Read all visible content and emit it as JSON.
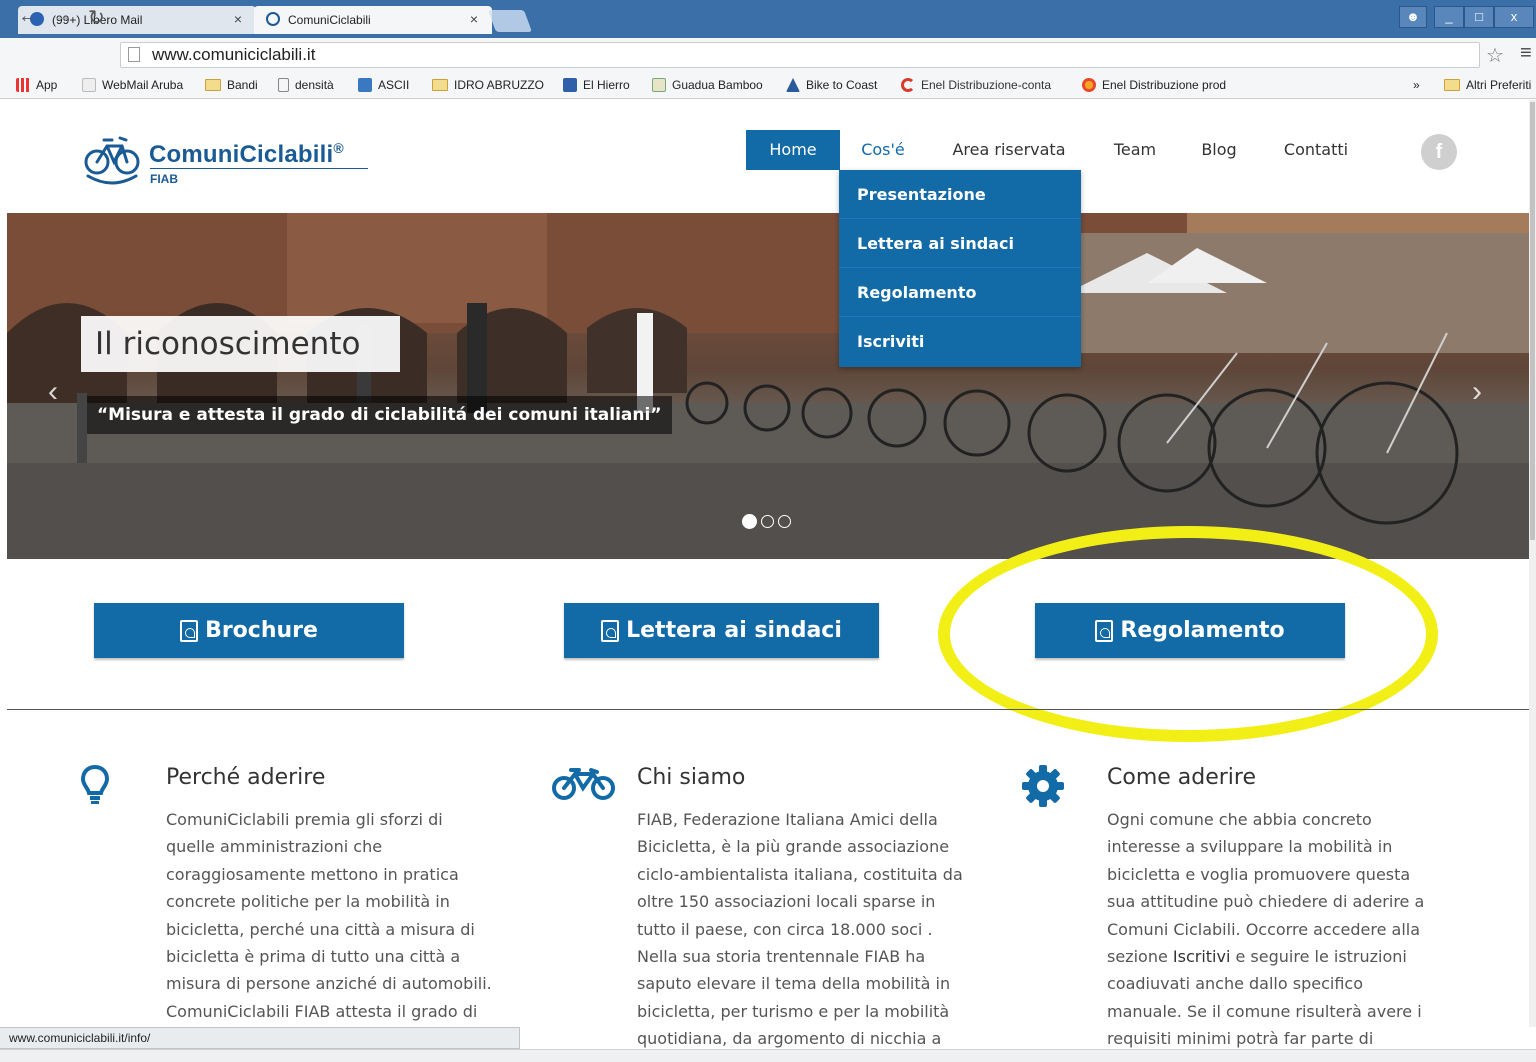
{
  "browser": {
    "tabs": [
      {
        "title": "(99+) Libero Mail",
        "close": "×"
      },
      {
        "title": "ComuniCiclabili",
        "close": "×"
      }
    ],
    "url": "www.comuniciclabili.it",
    "window_controls": [
      "_",
      "□",
      "x"
    ],
    "bookmarks": [
      {
        "label": "App",
        "icon": "apps-icon"
      },
      {
        "label": "WebMail Aruba",
        "icon": "mail-icon"
      },
      {
        "label": "Bandi",
        "icon": "folder-icon"
      },
      {
        "label": "densità",
        "icon": "page-icon"
      },
      {
        "label": "ASCII",
        "icon": "ascii-icon"
      },
      {
        "label": "IDRO ABRUZZO",
        "icon": "folder-icon"
      },
      {
        "label": "El Hierro",
        "icon": "hierro-icon"
      },
      {
        "label": "Guadua Bamboo",
        "icon": "bamboo-icon"
      },
      {
        "label": "Bike to Coast",
        "icon": "bike-coast-icon"
      },
      {
        "label": "Enel Distribuzione-conta",
        "icon": "enel-icon"
      },
      {
        "label": "Enel Distribuzione prod",
        "icon": "enel-star-icon"
      }
    ],
    "overflow": "»",
    "other_bookmarks": "Altri Preferiti",
    "status_url": "www.comuniciclabili.it/info/"
  },
  "site": {
    "logo": {
      "name": "ComuniCiclabili",
      "mark": "®",
      "sub": "FIAB"
    },
    "nav": [
      {
        "label": "Home",
        "state": "active"
      },
      {
        "label": "Cos'é",
        "state": "open"
      },
      {
        "label": "Area riservata",
        "state": ""
      },
      {
        "label": "Team",
        "state": ""
      },
      {
        "label": "Blog",
        "state": ""
      },
      {
        "label": "Contatti",
        "state": ""
      }
    ],
    "facebook": "f",
    "dropdown": [
      "Presentazione",
      "Lettera ai sindaci",
      "Regolamento",
      "Iscriviti"
    ],
    "slider": {
      "title": "Il riconoscimento",
      "subtitle": "“Misura e attesta il grado di ciclabilitá dei comuni italiani”",
      "prev": "‹",
      "next": "›",
      "current_slide": 1,
      "total_slides": 3
    },
    "buttons": [
      "Brochure",
      "Lettera ai sindaci",
      "Regolamento"
    ],
    "highlight_color": "#f2ef16",
    "accent_color": "#126aa7",
    "columns": [
      {
        "icon": "lightbulb-icon",
        "title": "Perché aderire",
        "lines": [
          "ComuniCiclabili premia gli sforzi di",
          "quelle amministrazioni che",
          "coraggiosamente mettono in pratica",
          "concrete politiche per la mobilità in",
          "bicicletta, perché una città a misura di",
          "bicicletta è prima di tutto una città a",
          "misura di persone anziché di automobili.",
          "ComuniCiclabili FIAB attesta il grado di"
        ]
      },
      {
        "icon": "bicycle-icon",
        "title": "Chi siamo",
        "lines": [
          "FIAB, Federazione Italiana Amici della",
          "Bicicletta, è la più grande associazione",
          "ciclo-ambientalista italiana, costituita da",
          "oltre 150 associazioni locali sparse in",
          "tutto il paese, con circa 18.000 soci .",
          "Nella sua storia trentennale FIAB ha",
          "saputo elevare il tema della mobilità in",
          "bicicletta, per turismo e per la mobilità",
          "quotidiana, da argomento di nicchia a"
        ]
      },
      {
        "icon": "gear-icon",
        "title": "Come aderire",
        "lines": [
          "Ogni comune che abbia concreto",
          "interesse a sviluppare la mobilità in",
          "bicicletta e voglia promuovere questa",
          "sua attitudine può chiedere di aderire a",
          "Comuni Ciclabili. Occorre accedere alla"
        ],
        "line6": {
          "before": "sezione ",
          "bold": "Iscritivi",
          "after": " e seguire le istruzioni"
        },
        "lines_after": [
          "coadiuvati anche dallo specifico",
          "manuale. Se il comune risulterà avere i",
          "requisiti minimi potrà far parte di"
        ]
      }
    ]
  }
}
